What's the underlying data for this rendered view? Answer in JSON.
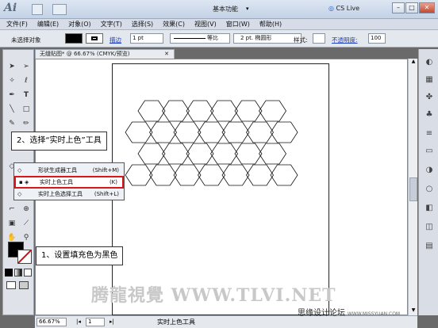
{
  "app": {
    "logo": "Ai",
    "workspace": "基本功能",
    "cs_live": "CS Live"
  },
  "menu": [
    "文件(F)",
    "编辑(E)",
    "对象(O)",
    "文字(T)",
    "选择(S)",
    "效果(C)",
    "视图(V)",
    "窗口(W)",
    "帮助(H)"
  ],
  "control_bar": {
    "selection_status": "未选择对象",
    "stroke_label": "描边",
    "stroke_value": "1 pt",
    "stroke_profile": "等比",
    "brush": "2 pt. 椭圆形",
    "style_label": "样式:",
    "opacity_label": "不透明度:",
    "opacity_value": "100"
  },
  "document": {
    "tab_title": "无缝贴图* @ 66.67% (CMYK/预览)"
  },
  "callouts": {
    "step2": "2、选择“实时上色”工具",
    "step1": "1、设置填充色为黑色"
  },
  "flyout": [
    {
      "label": "形状生成器工具",
      "shortcut": "(Shift+M)"
    },
    {
      "label": "实时上色工具",
      "shortcut": "(K)",
      "selected": true
    },
    {
      "label": "实时上色选择工具",
      "shortcut": "(Shift+L)"
    }
  ],
  "status": {
    "zoom": "66.67%",
    "page": "1",
    "tool": "实时上色工具"
  },
  "watermark": {
    "main": "腾龍視覺 WWW.TLVI.NET",
    "site": "思缘设计论坛",
    "url": "WWW.MISSYUAN.COM"
  },
  "colors": {
    "highlight": "#d81818",
    "fill": "#000000",
    "menu_bg": "#d6dde8"
  }
}
